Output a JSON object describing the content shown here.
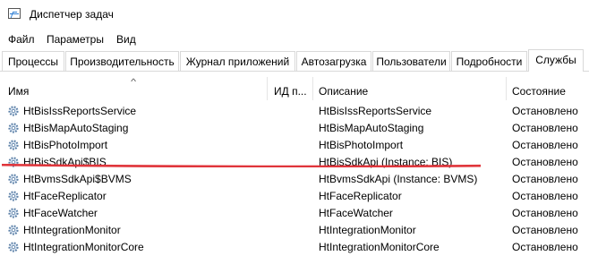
{
  "window": {
    "title": "Диспетчер задач"
  },
  "menu": [
    "Файл",
    "Параметры",
    "Вид"
  ],
  "tabs": [
    "Процессы",
    "Производительность",
    "Журнал приложений",
    "Автозагрузка",
    "Пользователи",
    "Подробности",
    "Службы"
  ],
  "active_tab": "Службы",
  "columns": {
    "name": "Имя",
    "pid": "ИД п...",
    "description": "Описание",
    "status": "Состояние"
  },
  "services": [
    {
      "name": "HtBisIssReportsService",
      "pid": "",
      "description": "HtBisIssReportsService",
      "status": "Остановлено"
    },
    {
      "name": "HtBisMapAutoStaging",
      "pid": "",
      "description": "HtBisMapAutoStaging",
      "status": "Остановлено"
    },
    {
      "name": "HtBisPhotoImport",
      "pid": "",
      "description": "HtBisPhotoImport",
      "status": "Остановлено"
    },
    {
      "name": "HtBisSdkApi$BIS",
      "pid": "",
      "description": "HtBisSdkApi (Instance: BIS)",
      "status": "Остановлено"
    },
    {
      "name": "HtBvmsSdkApi$BVMS",
      "pid": "",
      "description": "HtBvmsSdkApi (Instance: BVMS)",
      "status": "Остановлено"
    },
    {
      "name": "HtFaceReplicator",
      "pid": "",
      "description": "HtFaceReplicator",
      "status": "Остановлено"
    },
    {
      "name": "HtFaceWatcher",
      "pid": "",
      "description": "HtFaceWatcher",
      "status": "Остановлено"
    },
    {
      "name": "HtIntegrationMonitor",
      "pid": "",
      "description": "HtIntegrationMonitor",
      "status": "Остановлено"
    },
    {
      "name": "HtIntegrationMonitorCore",
      "pid": "",
      "description": "HtIntegrationMonitorCore",
      "status": "Остановлено"
    }
  ],
  "colors": {
    "highlight_line": "#e0353b",
    "gear": "#5b7fa6"
  },
  "icons": {
    "service": "gear-icon",
    "app": "task-manager-icon",
    "sort": "sort-ascending-icon"
  }
}
